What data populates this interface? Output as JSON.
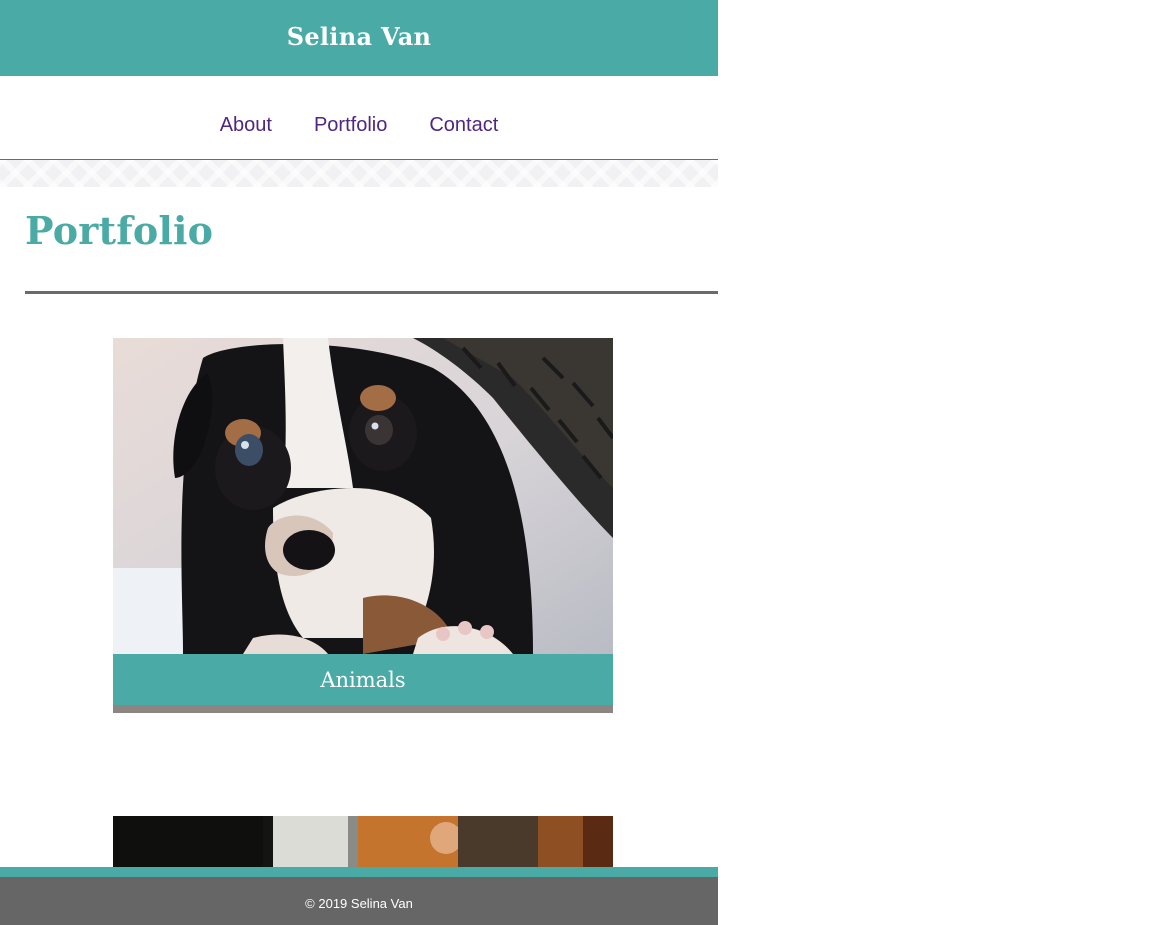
{
  "header": {
    "title": "Selina Van"
  },
  "nav": {
    "items": [
      {
        "label": "About"
      },
      {
        "label": "Portfolio"
      },
      {
        "label": "Contact"
      }
    ]
  },
  "main": {
    "title": "Portfolio",
    "cards": [
      {
        "label": "Animals"
      }
    ]
  },
  "footer": {
    "copyright": "© 2019 Selina Van"
  },
  "colors": {
    "accent": "#4aaaa5",
    "nav_link": "#4f2683",
    "footer_bg": "#666666"
  }
}
